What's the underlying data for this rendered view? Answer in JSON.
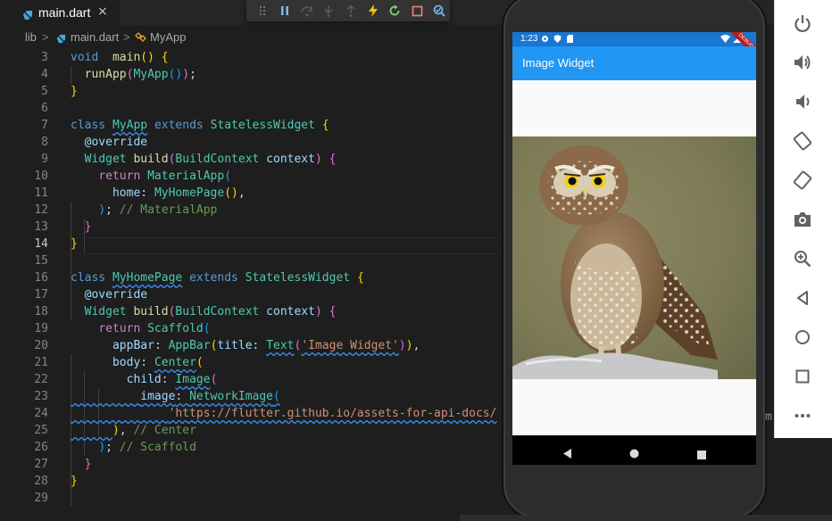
{
  "editor": {
    "tab": {
      "file_name": "main.dart",
      "close_symbol": "×"
    },
    "breadcrumb": {
      "root": "lib",
      "sep": ">",
      "file": "main.dart",
      "symbol": "MyApp"
    },
    "debug_toolbar": [
      "drag-handle",
      "pause",
      "step-over",
      "step-into",
      "step-out",
      "hot-reload",
      "hot-restart",
      "stop",
      "inspector"
    ]
  },
  "code": {
    "lines": [
      {
        "n": "3",
        "tokens": [
          [
            "kw",
            "void"
          ],
          [
            "",
            "  "
          ],
          [
            "fn",
            "main"
          ],
          [
            "b1",
            "()"
          ],
          [
            "",
            ""
          ],
          [
            "b1",
            " {"
          ]
        ]
      },
      {
        "n": "4",
        "tokens": [
          [
            "",
            "  "
          ],
          [
            "fn",
            "runApp"
          ],
          [
            "b2",
            "("
          ],
          [
            "cls",
            "MyApp"
          ],
          [
            "b3",
            "()"
          ],
          [
            "b2",
            ")"
          ],
          [
            "",
            ";"
          ]
        ]
      },
      {
        "n": "5",
        "tokens": [
          [
            "b1",
            "}"
          ]
        ]
      },
      {
        "n": "6",
        "tokens": []
      },
      {
        "n": "7",
        "tokens": [
          [
            "kw",
            "class"
          ],
          [
            "",
            " "
          ],
          [
            "cls sq",
            "MyApp"
          ],
          [
            "",
            " "
          ],
          [
            "kw",
            "extends"
          ],
          [
            "",
            " "
          ],
          [
            "cls",
            "StatelessWidget"
          ],
          [
            "",
            " "
          ],
          [
            "b1",
            "{"
          ]
        ]
      },
      {
        "n": "8",
        "tokens": [
          [
            "",
            "  "
          ],
          [
            "prm",
            "@override"
          ]
        ]
      },
      {
        "n": "9",
        "tokens": [
          [
            "",
            "  "
          ],
          [
            "cls",
            "Widget"
          ],
          [
            "",
            " "
          ],
          [
            "fn",
            "build"
          ],
          [
            "b2",
            "("
          ],
          [
            "cls",
            "BuildContext"
          ],
          [
            "",
            " "
          ],
          [
            "prm",
            "context"
          ],
          [
            "b2",
            ")"
          ],
          [
            "",
            " "
          ],
          [
            "b2",
            "{"
          ]
        ]
      },
      {
        "n": "10",
        "tokens": [
          [
            "",
            "    "
          ],
          [
            "ctl",
            "return"
          ],
          [
            "",
            " "
          ],
          [
            "cls",
            "MaterialApp"
          ],
          [
            "b3",
            "("
          ]
        ]
      },
      {
        "n": "11",
        "tokens": [
          [
            "",
            "      "
          ],
          [
            "prm",
            "home"
          ],
          [
            "",
            ": "
          ],
          [
            "cls",
            "MyHomePage"
          ],
          [
            "b1",
            "()"
          ],
          [
            "",
            ","
          ]
        ]
      },
      {
        "n": "12",
        "tokens": [
          [
            "",
            "    "
          ],
          [
            "b3",
            ")"
          ],
          [
            "",
            "; "
          ],
          [
            "cmt",
            "// MaterialApp"
          ]
        ]
      },
      {
        "n": "13",
        "tokens": [
          [
            "",
            "  "
          ],
          [
            "b2",
            "}"
          ]
        ]
      },
      {
        "n": "14",
        "tokens": [
          [
            "b1",
            "}"
          ]
        ]
      },
      {
        "n": "15",
        "tokens": []
      },
      {
        "n": "16",
        "tokens": [
          [
            "kw",
            "class"
          ],
          [
            "",
            " "
          ],
          [
            "cls sq",
            "MyHomePage"
          ],
          [
            "",
            " "
          ],
          [
            "kw",
            "extends"
          ],
          [
            "",
            " "
          ],
          [
            "cls",
            "StatelessWidget"
          ],
          [
            "",
            " "
          ],
          [
            "b1",
            "{"
          ]
        ]
      },
      {
        "n": "17",
        "tokens": [
          [
            "",
            "  "
          ],
          [
            "prm",
            "@override"
          ]
        ]
      },
      {
        "n": "18",
        "tokens": [
          [
            "",
            "  "
          ],
          [
            "cls",
            "Widget"
          ],
          [
            "",
            " "
          ],
          [
            "fn",
            "build"
          ],
          [
            "b2",
            "("
          ],
          [
            "cls",
            "BuildContext"
          ],
          [
            "",
            " "
          ],
          [
            "prm",
            "context"
          ],
          [
            "b2",
            ")"
          ],
          [
            "",
            " "
          ],
          [
            "b2",
            "{"
          ]
        ]
      },
      {
        "n": "19",
        "tokens": [
          [
            "",
            "    "
          ],
          [
            "ctl",
            "return"
          ],
          [
            "",
            " "
          ],
          [
            "cls",
            "Scaffold"
          ],
          [
            "b3",
            "("
          ]
        ]
      },
      {
        "n": "20",
        "tokens": [
          [
            "",
            "      "
          ],
          [
            "prm",
            "appBar"
          ],
          [
            "",
            ": "
          ],
          [
            "cls",
            "AppBar"
          ],
          [
            "b1",
            "("
          ],
          [
            "prm",
            "title"
          ],
          [
            "",
            ": "
          ],
          [
            "cls sq",
            "Text"
          ],
          [
            "b2",
            "("
          ],
          [
            "str sq",
            "'Image Widget'"
          ],
          [
            "b2",
            ")"
          ],
          [
            "b1",
            ")"
          ],
          [
            "",
            ","
          ]
        ]
      },
      {
        "n": "21",
        "tokens": [
          [
            "",
            "      "
          ],
          [
            "prm",
            "body"
          ],
          [
            "",
            ": "
          ],
          [
            "cls sq",
            "Center"
          ],
          [
            "b1",
            "("
          ]
        ]
      },
      {
        "n": "22",
        "tokens": [
          [
            "",
            "        "
          ],
          [
            "prm",
            "child"
          ],
          [
            "",
            ": "
          ],
          [
            "cls sq",
            "Image"
          ],
          [
            "b2",
            "("
          ]
        ]
      },
      {
        "n": "23",
        "tokens": [
          [
            "sq",
            "          "
          ],
          [
            "prm sq",
            "image"
          ],
          [
            "sq",
            ": "
          ],
          [
            "cls sq",
            "NetworkImage"
          ],
          [
            "b3 sq",
            "("
          ]
        ]
      },
      {
        "n": "24",
        "tokens": [
          [
            "sq",
            "              "
          ],
          [
            "str sq",
            "'https://flutter.github.io/assets-for-api-docs/"
          ]
        ]
      },
      {
        "n": "25",
        "tokens": [
          [
            "sq",
            "      "
          ],
          [
            "b1",
            ")"
          ],
          [
            "",
            ", "
          ],
          [
            "cmt",
            "// Center"
          ]
        ]
      },
      {
        "n": "26",
        "tokens": [
          [
            "",
            "    "
          ],
          [
            "b3",
            ")"
          ],
          [
            "",
            "; "
          ],
          [
            "cmt",
            "// Scaffold"
          ]
        ]
      },
      {
        "n": "27",
        "tokens": [
          [
            "",
            "  "
          ],
          [
            "b2",
            "}"
          ]
        ]
      },
      {
        "n": "28",
        "tokens": [
          [
            "b1",
            "}"
          ]
        ]
      },
      {
        "n": "29",
        "tokens": []
      }
    ]
  },
  "device": {
    "status_time": "1:23",
    "appbar_title": "Image Widget",
    "debug_banner": "DEBUG",
    "image_subject": "owl-photo"
  },
  "emulator_panel": [
    "power",
    "volume-up",
    "volume-down",
    "rotate-left",
    "rotate-right",
    "screenshot",
    "zoom",
    "back",
    "home",
    "overview",
    "more"
  ],
  "background_text": "m",
  "colors": {
    "editor_bg": "#1e1e1e",
    "appbar": "#2196f3",
    "status_bar": "#1976d2",
    "emulator_icon": "#5f6368"
  }
}
